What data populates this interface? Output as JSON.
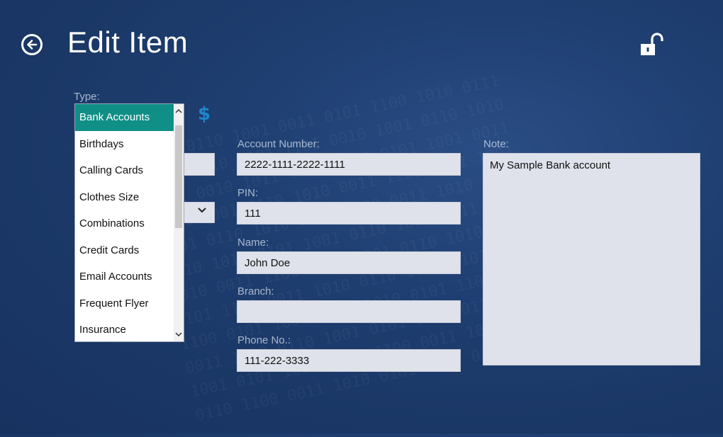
{
  "header": {
    "title": "Edit Item"
  },
  "type_field": {
    "label": "Type:",
    "options": [
      "Bank Accounts",
      "Birthdays",
      "Calling Cards",
      "Clothes Size",
      "Combinations",
      "Credit Cards",
      "Email Accounts",
      "Frequent Flyer",
      "Insurance"
    ],
    "selected": "Bank Accounts",
    "icon": "dollar-icon",
    "icon_glyph": "$",
    "icon_color": "#1f86c9"
  },
  "fields": {
    "account_number": {
      "label": "Account Number:",
      "value": "2222-1111-2222-1111"
    },
    "pin": {
      "label": "PIN:",
      "value": "111"
    },
    "name": {
      "label": "Name:",
      "value": "John Doe"
    },
    "branch": {
      "label": "Branch:",
      "value": ""
    },
    "phone": {
      "label": "Phone No.:",
      "value": "111-222-3333"
    }
  },
  "note": {
    "label": "Note:",
    "value": "My Sample Bank account"
  },
  "colors": {
    "background": "#1f3f72",
    "selected_option": "#0f8f86",
    "field_background": "#dfe2ea"
  }
}
